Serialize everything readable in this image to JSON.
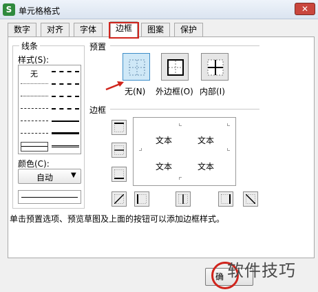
{
  "window": {
    "title": "单元格格式",
    "app_icon": "S",
    "close_glyph": "✕"
  },
  "tabs": [
    {
      "label": "数字",
      "active": false
    },
    {
      "label": "对齐",
      "active": false
    },
    {
      "label": "字体",
      "active": false
    },
    {
      "label": "边框",
      "active": true
    },
    {
      "label": "图案",
      "active": false
    },
    {
      "label": "保护",
      "active": false
    }
  ],
  "line": {
    "group_label": "线条",
    "style_label": "样式(S):",
    "none_label": "无",
    "color_label": "颜色(C):",
    "color_value": "自动",
    "color_arrow": "▼"
  },
  "presets": {
    "label": "预置",
    "buttons": [
      {
        "label": "无(N)",
        "icon": "border-none-icon",
        "highlighted": true
      },
      {
        "label": "外边框(O)",
        "icon": "border-outline-icon",
        "highlighted": false
      },
      {
        "label": "内部(I)",
        "icon": "border-inside-icon",
        "highlighted": false
      }
    ]
  },
  "border": {
    "label": "边框",
    "preview_text": [
      "文本",
      "文本",
      "文本",
      "文本"
    ],
    "buttons": [
      "border-top-icon",
      "border-middle-horizontal-icon",
      "border-bottom-icon",
      "border-diagonal-up-icon",
      "border-left-icon",
      "border-middle-vertical-icon",
      "border-right-icon",
      "border-diagonal-down-icon"
    ]
  },
  "hint": "单击预置选项、预览草图及上面的按钮可以添加边框样式。",
  "footer": {
    "ok_label": "确"
  },
  "watermark": "软件技巧",
  "colors": {
    "highlight_red": "#d0241c",
    "preset_highlight": "#cfe8f7"
  }
}
